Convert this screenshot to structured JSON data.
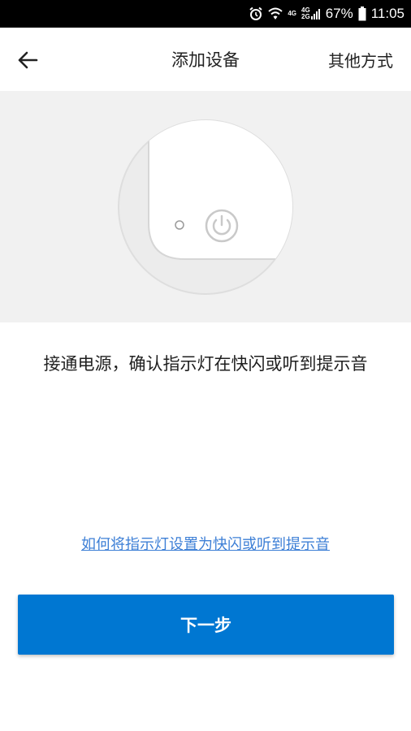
{
  "status_bar": {
    "battery": "67%",
    "time": "11:05",
    "network_4g": "4G",
    "network_4g_lte": "4G",
    "network_2g": "2G",
    "icons": [
      "alarm-icon",
      "wifi-icon",
      "signal-icon",
      "battery-icon"
    ]
  },
  "header": {
    "title": "添加设备",
    "other_method": "其他方式"
  },
  "main": {
    "instruction": "接通电源，确认指示灯在快闪或听到提示音",
    "help_link": "如何将指示灯设置为快闪或听到提示音",
    "next_button": "下一步"
  },
  "colors": {
    "primary": "#0077d2",
    "link": "#3d7fd6",
    "hero_background": "#f1f1f1"
  }
}
